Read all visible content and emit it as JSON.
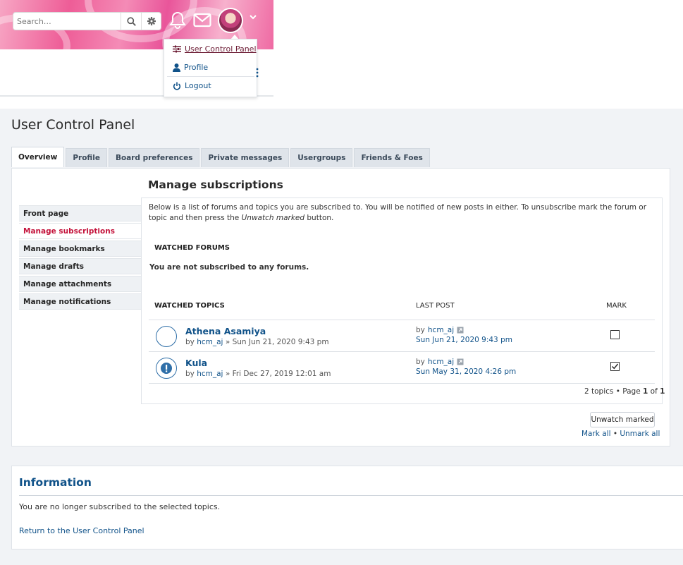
{
  "header": {
    "search_placeholder": "Search…",
    "icons": [
      "search-icon",
      "gear-icon",
      "bell-icon",
      "envelope-icon",
      "avatar",
      "chevron-down-icon"
    ]
  },
  "user_menu": {
    "items": [
      {
        "label": "User Control Panel",
        "icon": "sliders-icon"
      },
      {
        "label": "Profile",
        "icon": "user-icon"
      },
      {
        "label": "Logout",
        "icon": "power-icon"
      }
    ]
  },
  "page": {
    "title": "User Control Panel",
    "tabs": [
      "Overview",
      "Profile",
      "Board preferences",
      "Private messages",
      "Usergroups",
      "Friends & Foes"
    ],
    "active_tab": "Overview"
  },
  "side_nav": {
    "items": [
      "Front page",
      "Manage subscriptions",
      "Manage bookmarks",
      "Manage drafts",
      "Manage attachments",
      "Manage notifications"
    ],
    "active": "Manage subscriptions"
  },
  "main": {
    "section_title": "Manage subscriptions",
    "intro_before": "Below is a list of forums and topics you are subscribed to. You will be notified of new posts in either. To unsubscribe mark the forum or topic and then press the ",
    "intro_italic": "Unwatch marked",
    "intro_after": " button.",
    "watched_forums_header": "WATCHED FORUMS",
    "no_forums_text": "You are not subscribed to any forums.",
    "watched_topics_header": "WATCHED TOPICS",
    "last_post_header": "LAST POST",
    "mark_header": "MARK",
    "topics": [
      {
        "title": "Athena Asamiya",
        "by_prefix": "by ",
        "author": "hcm_aj",
        "date_text": " » Sun Jun 21, 2020 9:43 pm",
        "last_by_prefix": "by ",
        "last_author": "hcm_aj",
        "last_date": "Sun Jun 21, 2020 9:43 pm",
        "marked": false,
        "icon": "topic-read-icon"
      },
      {
        "title": "Kula",
        "by_prefix": "by ",
        "author": "hcm_aj",
        "date_text": " » Fri Dec 27, 2019 12:01 am",
        "last_by_prefix": "by ",
        "last_author": "hcm_aj",
        "last_date": "Sun May 31, 2020 4:26 pm",
        "marked": true,
        "icon": "topic-important-icon"
      }
    ],
    "pagination": {
      "prefix": "2 topics • Page ",
      "current": "1",
      "middle": " of ",
      "total": "1"
    },
    "unwatch_button": "Unwatch marked",
    "mark_all": "Mark all",
    "mark_sep": " • ",
    "unmark_all": "Unmark all"
  },
  "info": {
    "title": "Information",
    "message": "You are no longer subscribed to the selected topics.",
    "return_link": "Return to the User Control Panel"
  }
}
